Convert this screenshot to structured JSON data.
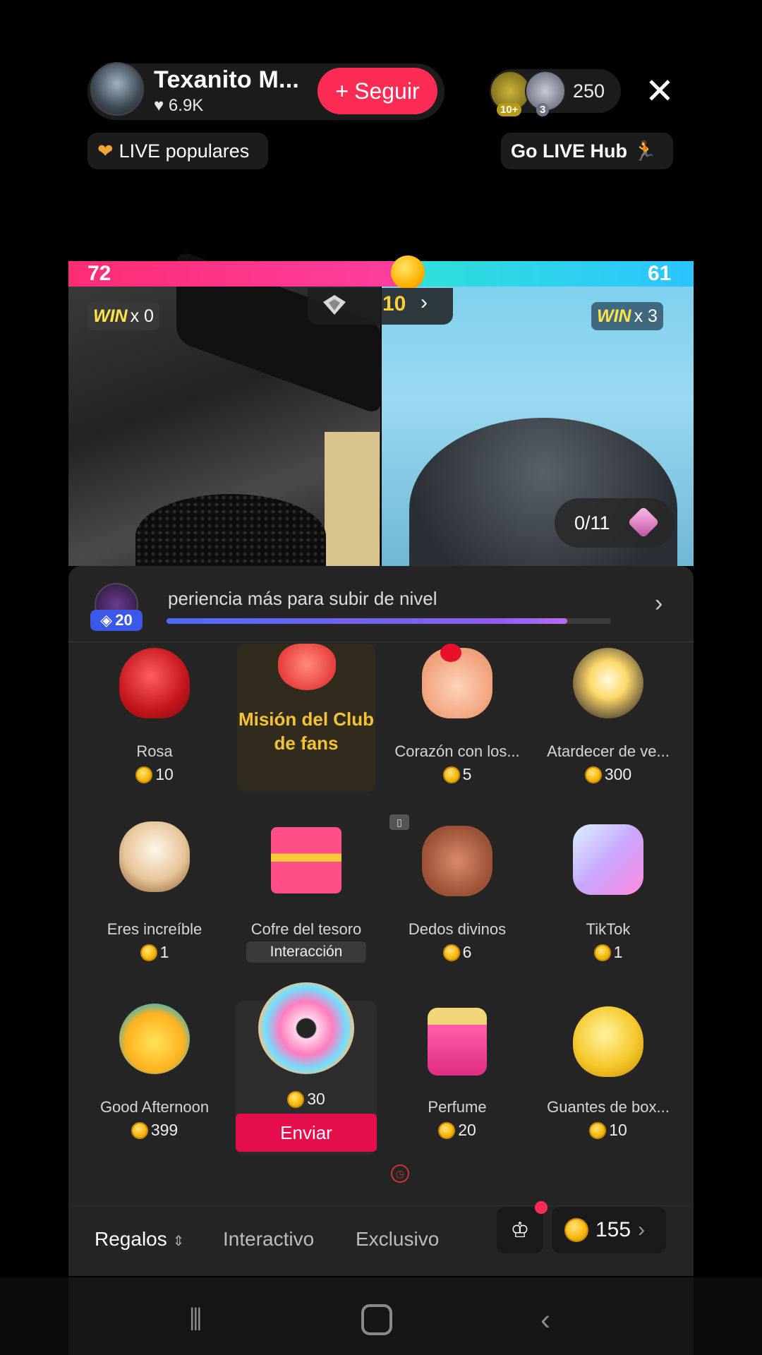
{
  "header": {
    "host_name": "Texanito M...",
    "host_likes": "6.9K",
    "follow_label": "Seguir",
    "viewer_badges": [
      "10+",
      "3"
    ],
    "viewer_count": "250",
    "live_chip": "LIVE populares",
    "hub_chip": "Go LIVE Hub"
  },
  "battle": {
    "score_left": "72",
    "score_right": "61",
    "left_win_label": "WIN",
    "left_win_count": "x 0",
    "right_win_label": "WIN",
    "right_win_count": "x 3",
    "center_value": "10",
    "progress": "0/11",
    "score_split": 0.54
  },
  "level": {
    "badge": "20",
    "message": "periencia más para subir de nivel",
    "progress": 0.9
  },
  "fan_mission": "Misión del Club de fans",
  "gifts": [
    {
      "name": "Rosa",
      "price": "10"
    },
    {
      "name": "Corazón con los...",
      "price": "5"
    },
    {
      "name": "Atardecer de ve...",
      "price": "300"
    },
    {
      "name": "Eres increíble",
      "price": "1"
    },
    {
      "name": "Cofre del tesoro",
      "tag": "Interacción"
    },
    {
      "name": "Dedos divinos",
      "price": "6"
    },
    {
      "name": "TikTok",
      "price": "1"
    },
    {
      "name": "Good Afternoon",
      "price": "399"
    },
    {
      "price": "30"
    },
    {
      "name": "Perfume",
      "price": "20"
    },
    {
      "name": "Guantes de box...",
      "price": "10"
    }
  ],
  "send_label": "Enviar",
  "tabs": {
    "gifts": "Regalos",
    "interactive": "Interactivo",
    "exclusive": "Exclusivo"
  },
  "coin_balance": "155",
  "colors": {
    "accent": "#fe2c55",
    "coin": "#f5b60a",
    "fan_gold": "#f4c236"
  }
}
